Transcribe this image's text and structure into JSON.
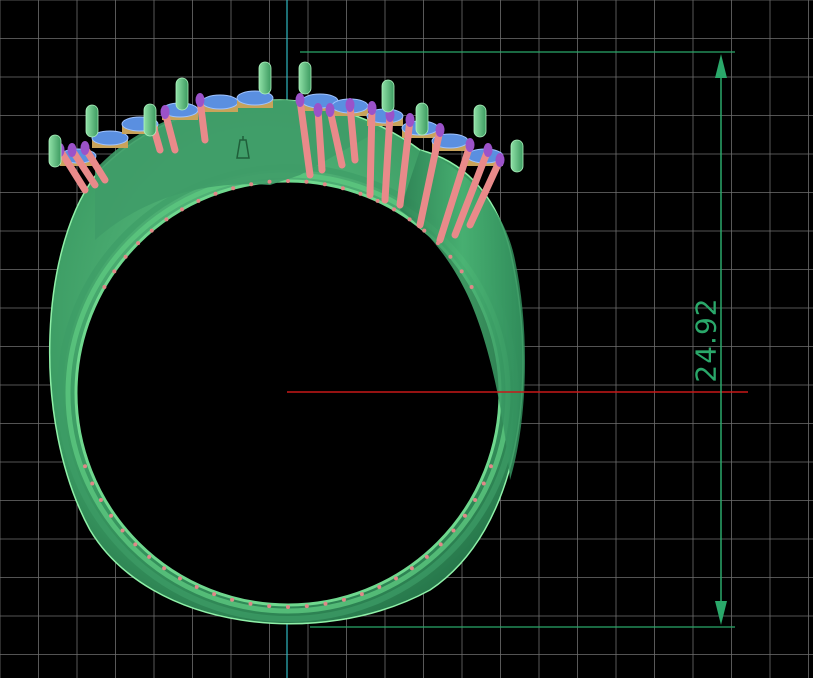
{
  "viewport": {
    "background": "#000000",
    "grid_color": "#6f6f6f",
    "axis_vertical_color": "#2fb8c0",
    "axis_horizontal_color": "#c81818"
  },
  "dimension": {
    "value": "24.92",
    "color": "#2aa86a"
  },
  "model": {
    "band_color": "#3fa86b",
    "band_highlight": "#7fe29b",
    "prong_color": "#e98a8a",
    "prong_tip_color": "#9b52c9",
    "gem_color": "#5a8fe0",
    "seat_color": "#c8a35a",
    "hallmark_icon": "hallmark-icon"
  }
}
